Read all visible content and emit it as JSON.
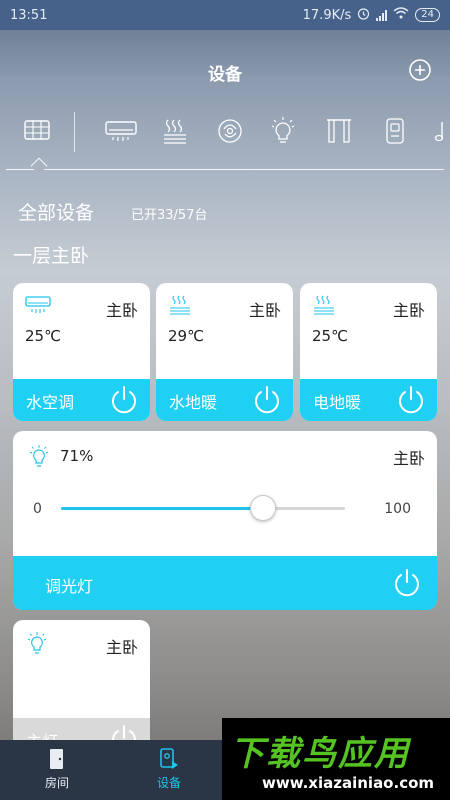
{
  "status_bar": {
    "time": "13:51",
    "net_speed": "17.9K/s",
    "battery": "24"
  },
  "header": {
    "title": "设备",
    "icons": [
      "add-icon"
    ]
  },
  "categories": {
    "icons": [
      "all-devices-icon",
      "air-conditioner-icon",
      "floor-heating-icon",
      "air-purifier-icon",
      "light-bulb-icon",
      "curtain-icon",
      "door-lock-icon",
      "music-icon"
    ],
    "selected": "all-devices-icon"
  },
  "summary": {
    "title": "全部设备",
    "count": "已开33/57台"
  },
  "floor": {
    "name": "一层主卧"
  },
  "devices": [
    {
      "room": "主卧",
      "temp": "25℃",
      "name": "水空调",
      "icon": "air-conditioner-icon"
    },
    {
      "room": "主卧",
      "temp": "29℃",
      "name": "水地暖",
      "icon": "floor-heating-icon"
    },
    {
      "room": "主卧",
      "temp": "25℃",
      "name": "电地暖",
      "icon": "floor-heating-icon"
    }
  ],
  "dimmer": {
    "room": "主卧",
    "percent_label": "71%",
    "min": "0",
    "max": "100",
    "level_fraction": 0.71,
    "name": "调光灯",
    "icon": "light-bulb-icon"
  },
  "partial_card": {
    "room": "主卧",
    "name": "主灯",
    "icon": "light-bulb-icon"
  },
  "bottom_nav": {
    "items": [
      {
        "label": "房间",
        "icon": "door-icon"
      },
      {
        "label": "设备",
        "icon": "device-icon"
      }
    ],
    "active": "设备"
  },
  "watermark": {
    "brand": "下载鸟应用",
    "url": "www.xiazainiao.com"
  },
  "colors": {
    "accent": "#1fd0f2",
    "status_bar": "#46628a",
    "bottom_nav": "#2a3646",
    "watermark_green": "#55c321"
  }
}
